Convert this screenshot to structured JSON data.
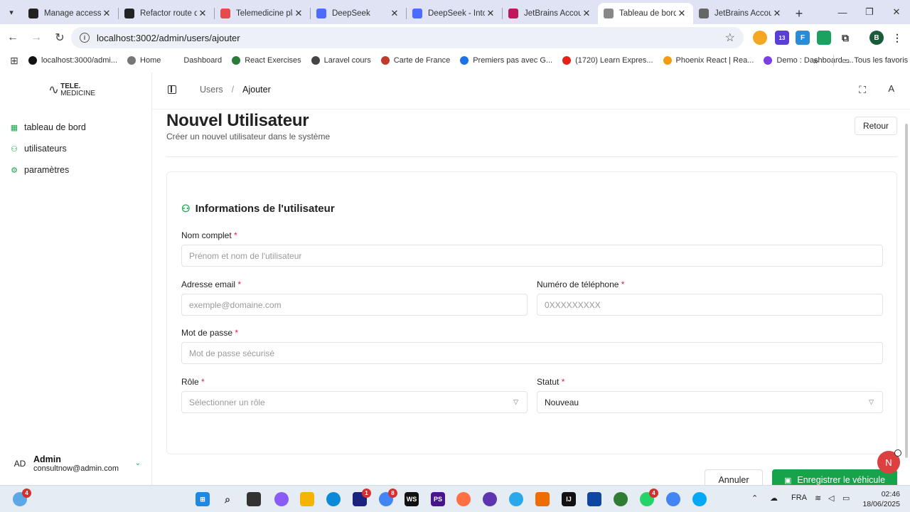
{
  "browser": {
    "tabs": [
      {
        "title": "Manage access",
        "icon": "github-icon",
        "color": "#222222",
        "active": false
      },
      {
        "title": "Refactor route d",
        "icon": "github-icon",
        "color": "#222222",
        "active": false
      },
      {
        "title": "Telemedicine pla",
        "icon": "figma-icon",
        "color": "#e24c4c",
        "active": false
      },
      {
        "title": "DeepSeek",
        "icon": "deepseek-icon",
        "color": "#4d6bfe",
        "active": false
      },
      {
        "title": "DeepSeek - Into",
        "icon": "deepseek-icon",
        "color": "#4d6bfe",
        "active": false
      },
      {
        "title": "JetBrains Accour",
        "icon": "jetbrains-icon",
        "color": "#c0165c",
        "active": false
      },
      {
        "title": "Tableau de bord",
        "icon": "stethoscope-icon",
        "color": "#888888",
        "active": true
      },
      {
        "title": "JetBrains Accou",
        "icon": "globe-icon",
        "color": "#666666",
        "active": false
      }
    ],
    "url": "localhost:3002/admin/users/ajouter",
    "bookmarks": [
      {
        "label": "localhost:3000/admi...",
        "color": "#111111"
      },
      {
        "label": "Home",
        "color": "#777777"
      },
      {
        "label": "Dashboard",
        "color": "#ffffff"
      },
      {
        "label": "React Exercises",
        "color": "#2a7a3a"
      },
      {
        "label": "Laravel cours",
        "color": "#444444"
      },
      {
        "label": "Carte de France",
        "color": "#c0392b"
      },
      {
        "label": "Premiers pas avec G...",
        "color": "#1a73e8"
      },
      {
        "label": "(1720) Learn Expres...",
        "color": "#e62117"
      },
      {
        "label": "Phoenix React | Rea...",
        "color": "#f39c12"
      },
      {
        "label": "Demo : Dashboard -...",
        "color": "#7b3fe4"
      }
    ],
    "bookmarks_more": "»",
    "all_bookmarks": "Tous les favoris",
    "profile_initial": "B",
    "ext_badge": "13"
  },
  "sidebar": {
    "logo": {
      "line1": "TELE.",
      "line2": "MEDICINE"
    },
    "items": [
      {
        "label": "tableau de bord",
        "icon": "dashboard-icon"
      },
      {
        "label": "utilisateurs",
        "icon": "users-icon"
      },
      {
        "label": "paramètres",
        "icon": "settings-icon"
      }
    ],
    "user": {
      "initials": "AD",
      "name": "Admin",
      "email": "consultnow@admin.com"
    }
  },
  "header": {
    "breadcrumb": [
      "Users",
      "Ajouter"
    ],
    "avatar": "A"
  },
  "page": {
    "title": "Nouvel Utilisateur",
    "subtitle": "Créer un nouvel utilisateur dans le système",
    "back_label": "Retour"
  },
  "form": {
    "section_title": "Informations de l'utilisateur",
    "full_name": {
      "label": "Nom complet",
      "placeholder": "Prénom et nom de l'utilisateur"
    },
    "email": {
      "label": "Adresse email",
      "placeholder": "exemple@domaine.com"
    },
    "phone": {
      "label": "Numéro de téléphone",
      "placeholder": "0XXXXXXXXX"
    },
    "password": {
      "label": "Mot de passe",
      "placeholder": "Mot de passe sécurisé"
    },
    "role": {
      "label": "Rôle",
      "placeholder": "Sélectionner un rôle"
    },
    "status": {
      "label": "Statut",
      "value": "Nouveau"
    },
    "required_mark": "*",
    "cancel_label": "Annuler",
    "save_label": "Enregistrer le véhicule"
  },
  "fab_label": "N",
  "colors": {
    "accent": "#16a34a",
    "required": "#e11d48"
  },
  "taskbar": {
    "weather_badge": "4",
    "badges": {
      "terminal": "1",
      "chrome": "8",
      "whatsapp": "4"
    },
    "language": "FRA",
    "time": "02:46",
    "date": "18/06/2025"
  }
}
